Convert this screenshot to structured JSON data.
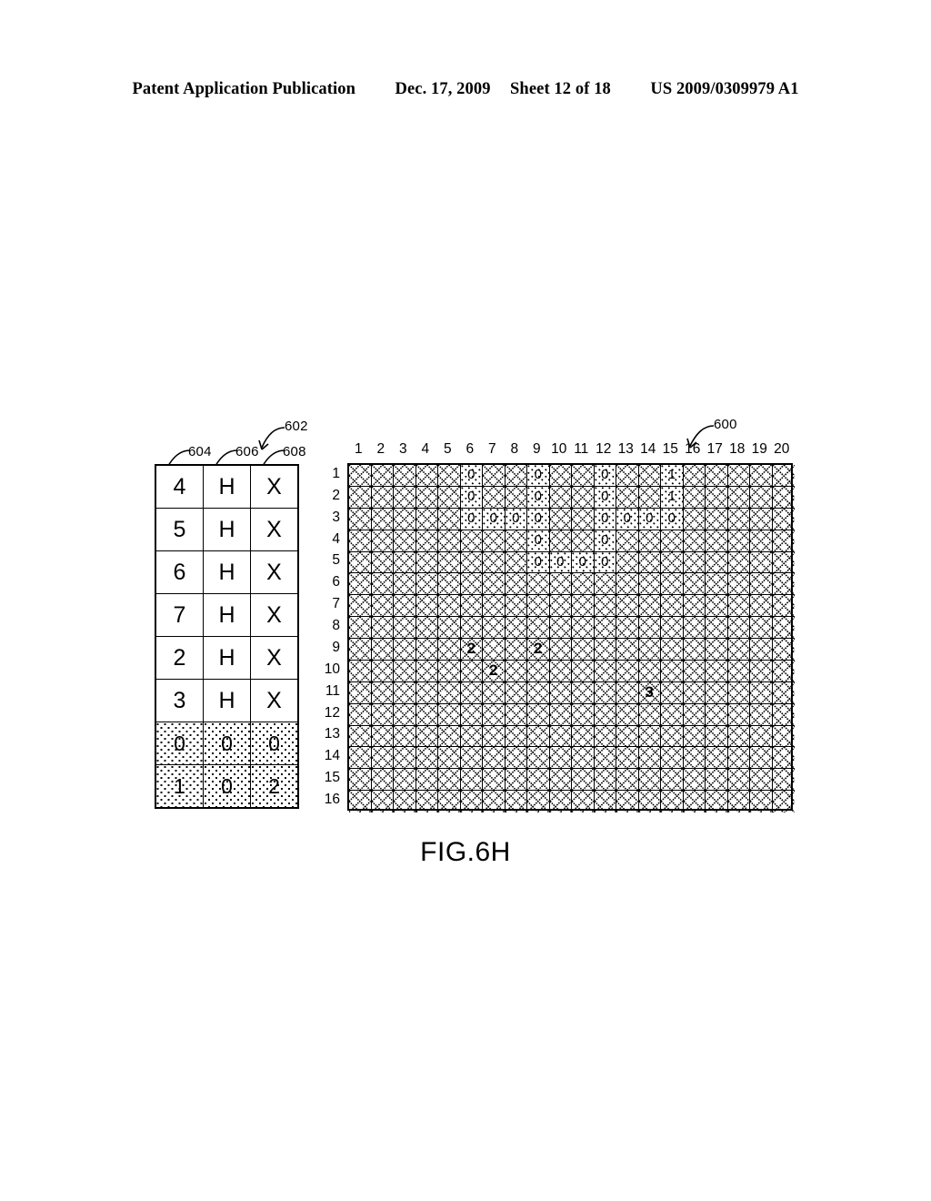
{
  "header": {
    "publication": "Patent Application Publication",
    "date": "Dec. 17, 2009",
    "sheet": "Sheet 12 of 18",
    "patent_number": "US 2009/0309979 A1"
  },
  "figure": {
    "caption": "FIG.6H",
    "refs": {
      "grid": "600",
      "table": "602",
      "col_index": "604",
      "col_type": "606",
      "col_flag": "608"
    }
  },
  "table602": {
    "columns": [
      "604",
      "606",
      "608"
    ],
    "rows": [
      {
        "cells": [
          "4",
          "H",
          "X"
        ],
        "stipple": false
      },
      {
        "cells": [
          "5",
          "H",
          "X"
        ],
        "stipple": false
      },
      {
        "cells": [
          "6",
          "H",
          "X"
        ],
        "stipple": false
      },
      {
        "cells": [
          "7",
          "H",
          "X"
        ],
        "stipple": false
      },
      {
        "cells": [
          "2",
          "H",
          "X"
        ],
        "stipple": false
      },
      {
        "cells": [
          "3",
          "H",
          "X"
        ],
        "stipple": false
      },
      {
        "cells": [
          "0",
          "0",
          "0"
        ],
        "stipple": true
      },
      {
        "cells": [
          "1",
          "0",
          "2"
        ],
        "stipple": true
      }
    ]
  },
  "grid600": {
    "col_labels": [
      "1",
      "2",
      "3",
      "4",
      "5",
      "6",
      "7",
      "8",
      "9",
      "10",
      "11",
      "12",
      "13",
      "14",
      "15",
      "16",
      "17",
      "18",
      "19",
      "20"
    ],
    "row_labels": [
      "1",
      "2",
      "3",
      "4",
      "5",
      "6",
      "7",
      "8",
      "9",
      "10",
      "11",
      "12",
      "13",
      "14",
      "15",
      "16"
    ],
    "cols": 20,
    "rows": 16,
    "marked_cells": [
      {
        "row": 1,
        "col": 6,
        "value": "0",
        "style": "stipple"
      },
      {
        "row": 1,
        "col": 9,
        "value": "0",
        "style": "stipple"
      },
      {
        "row": 1,
        "col": 12,
        "value": "0",
        "style": "stipple"
      },
      {
        "row": 1,
        "col": 15,
        "value": "1",
        "style": "stipple"
      },
      {
        "row": 2,
        "col": 6,
        "value": "0",
        "style": "stipple"
      },
      {
        "row": 2,
        "col": 9,
        "value": "0",
        "style": "stipple"
      },
      {
        "row": 2,
        "col": 12,
        "value": "0",
        "style": "stipple"
      },
      {
        "row": 2,
        "col": 15,
        "value": "1",
        "style": "stipple"
      },
      {
        "row": 3,
        "col": 6,
        "value": "0",
        "style": "stipple"
      },
      {
        "row": 3,
        "col": 7,
        "value": "0",
        "style": "stipple"
      },
      {
        "row": 3,
        "col": 8,
        "value": "0",
        "style": "stipple"
      },
      {
        "row": 3,
        "col": 9,
        "value": "0",
        "style": "stipple"
      },
      {
        "row": 3,
        "col": 12,
        "value": "0",
        "style": "stipple"
      },
      {
        "row": 3,
        "col": 13,
        "value": "0",
        "style": "stipple"
      },
      {
        "row": 3,
        "col": 14,
        "value": "0",
        "style": "stipple"
      },
      {
        "row": 3,
        "col": 15,
        "value": "0",
        "style": "stipple"
      },
      {
        "row": 4,
        "col": 9,
        "value": "0",
        "style": "stipple"
      },
      {
        "row": 4,
        "col": 12,
        "value": "0",
        "style": "stipple"
      },
      {
        "row": 5,
        "col": 9,
        "value": "0",
        "style": "stipple"
      },
      {
        "row": 5,
        "col": 10,
        "value": "0",
        "style": "stipple"
      },
      {
        "row": 5,
        "col": 11,
        "value": "0",
        "style": "stipple"
      },
      {
        "row": 5,
        "col": 12,
        "value": "0",
        "style": "stipple"
      },
      {
        "row": 9,
        "col": 6,
        "value": "2",
        "style": "plain"
      },
      {
        "row": 9,
        "col": 9,
        "value": "2",
        "style": "plain"
      },
      {
        "row": 10,
        "col": 7,
        "value": "2",
        "style": "plain"
      },
      {
        "row": 11,
        "col": 14,
        "value": "3",
        "style": "plain"
      }
    ]
  }
}
